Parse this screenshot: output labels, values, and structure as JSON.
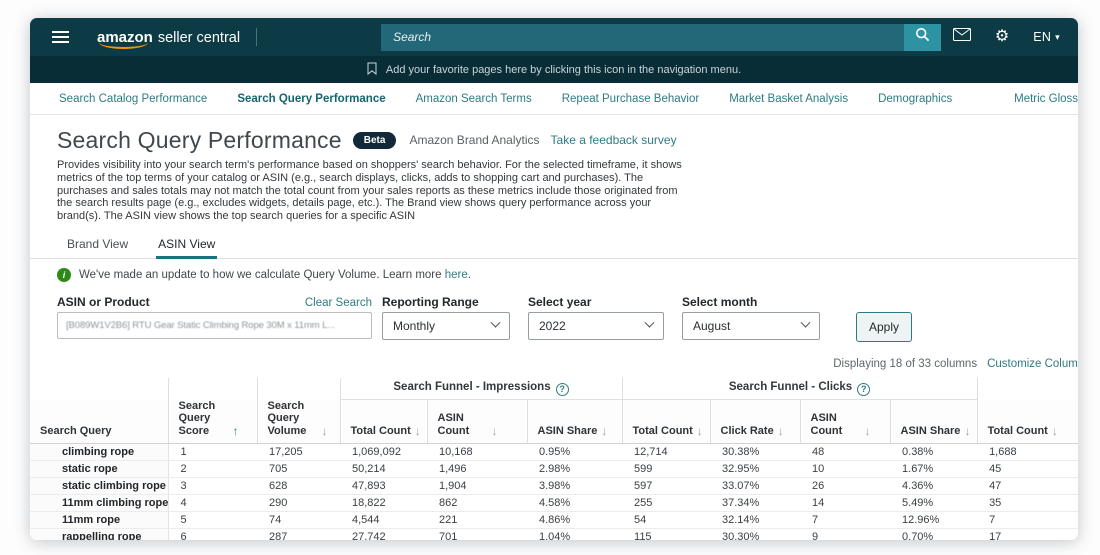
{
  "topbar": {
    "logo_amazon": "amazon",
    "logo_suffix": "seller central",
    "search_placeholder": "Search",
    "language": "EN"
  },
  "favbar": {
    "text": "Add your favorite pages here by clicking this icon in the navigation menu."
  },
  "nav": {
    "items": [
      "Search Catalog Performance",
      "Search Query Performance",
      "Amazon Search Terms",
      "Repeat Purchase Behavior",
      "Market Basket Analysis",
      "Demographics"
    ],
    "active_index": 1,
    "right_item": "Metric Glossary"
  },
  "header": {
    "title": "Search Query Performance",
    "beta_badge": "Beta",
    "subtitle": "Amazon Brand Analytics",
    "feedback_link": "Take a feedback survey",
    "description": "Provides visibility into your search term's performance based on shoppers' search behavior. For the selected timeframe, it shows metrics of the top terms of your catalog or ASIN (e.g., search displays, clicks, adds to shopping cart and purchases). The purchases and sales totals may not match the total count from your sales reports as these metrics include those originated from the search results page (e.g., excludes widgets, details page, etc.). The Brand view shows query performance across your brand(s). The ASIN view shows the top search queries for a specific ASIN"
  },
  "view_tabs": {
    "items": [
      "Brand View",
      "ASIN View"
    ],
    "active_index": 1
  },
  "notice": {
    "text": "We've made an update to how we calculate Query Volume. Learn more",
    "link": "here",
    "suffix": "."
  },
  "filters": {
    "asin": {
      "label": "ASIN or Product",
      "clear_link": "Clear Search",
      "value": "[B089W1V2B6] RTU Gear Static Climbing Rope 30M x 11mm L..."
    },
    "reporting_range": {
      "label": "Reporting Range",
      "value": "Monthly"
    },
    "year": {
      "label": "Select year",
      "value": "2022"
    },
    "month": {
      "label": "Select month",
      "value": "August"
    },
    "apply_label": "Apply"
  },
  "table_meta": {
    "displaying": "Displaying 18 of 33 columns",
    "customize_link": "Customize Columns"
  },
  "table": {
    "groups": [
      {
        "label": "",
        "span": 1,
        "help": false
      },
      {
        "label": "",
        "span": 1,
        "help": false
      },
      {
        "label": "",
        "span": 1,
        "help": false
      },
      {
        "label": "Search Funnel - Impressions",
        "span": 3,
        "help": true
      },
      {
        "label": "Search Funnel - Clicks",
        "span": 4,
        "help": true
      },
      {
        "label": "",
        "span": 1,
        "help": false
      }
    ],
    "columns": [
      {
        "label": "Search Query",
        "sort": null
      },
      {
        "label": "Search Query Score",
        "sort": "asc"
      },
      {
        "label": "Search Query Volume",
        "sort": "desc"
      },
      {
        "label": "Total Count",
        "sort": "desc"
      },
      {
        "label": "ASIN Count",
        "sort": "desc"
      },
      {
        "label": "ASIN Share",
        "sort": "desc"
      },
      {
        "label": "Total Count",
        "sort": "desc"
      },
      {
        "label": "Click Rate",
        "sort": "desc"
      },
      {
        "label": "ASIN Count",
        "sort": "desc"
      },
      {
        "label": "ASIN Share",
        "sort": "desc"
      },
      {
        "label": "Total Count",
        "sort": "desc"
      }
    ],
    "rows": [
      [
        "climbing rope",
        "1",
        "17,205",
        "1,069,092",
        "10,168",
        "0.95%",
        "12,714",
        "30.38%",
        "48",
        "0.38%",
        "1,688"
      ],
      [
        "static rope",
        "2",
        "705",
        "50,214",
        "1,496",
        "2.98%",
        "599",
        "32.95%",
        "10",
        "1.67%",
        "45"
      ],
      [
        "static climbing rope",
        "3",
        "628",
        "47,893",
        "1,904",
        "3.98%",
        "597",
        "33.07%",
        "26",
        "4.36%",
        "47"
      ],
      [
        "11mm climbing rope",
        "4",
        "290",
        "18,822",
        "862",
        "4.58%",
        "255",
        "37.34%",
        "14",
        "5.49%",
        "35"
      ],
      [
        "11mm rope",
        "5",
        "74",
        "4,544",
        "221",
        "4.86%",
        "54",
        "32.14%",
        "7",
        "12.96%",
        "7"
      ],
      [
        "rappelling rope",
        "6",
        "287",
        "27,742",
        "701",
        "1.04%",
        "115",
        "30.30%",
        "9",
        "0.70%",
        "17"
      ]
    ]
  },
  "colors": {
    "navbar_bg": "#0d3b45",
    "favbar_bg": "#082d36",
    "search_field_bg": "#236878",
    "search_button_bg": "#2d93a3",
    "accent_teal": "#2e7b82",
    "active_tab_underline": "#17747d",
    "notice_green": "#2b8a16",
    "beta_badge_bg": "#12293a",
    "sort_asc_green": "#2f8a5d",
    "apply_border": "#2b7a83"
  }
}
